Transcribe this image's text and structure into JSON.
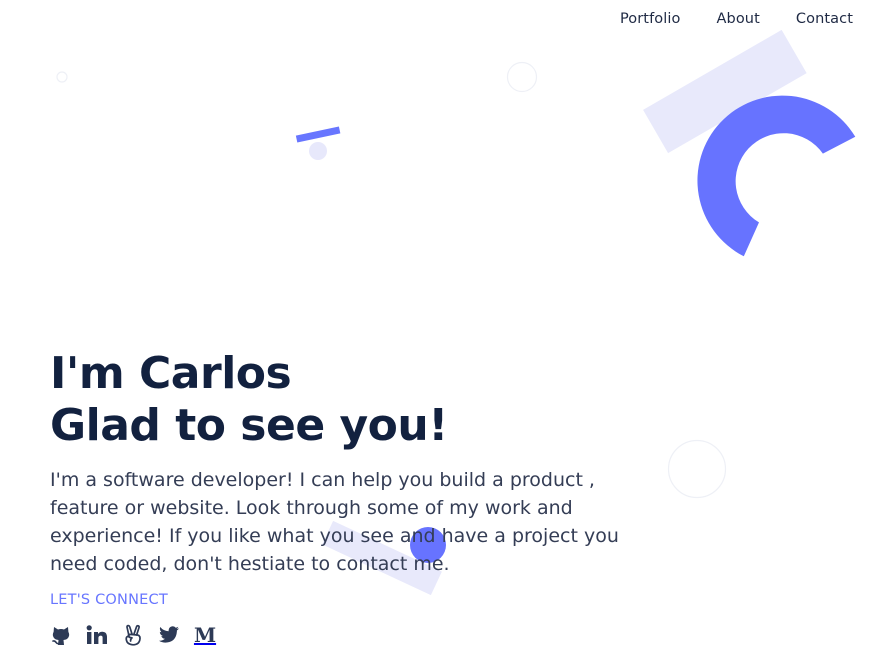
{
  "nav": {
    "items": [
      {
        "label": "Portfolio"
      },
      {
        "label": "About"
      },
      {
        "label": "Contact"
      }
    ]
  },
  "hero": {
    "title_line1": "I'm Carlos",
    "title_line2": "Glad to see you!",
    "description": "I'm a software developer! I can help you build a product , feature or website. Look through some of my work and experience! If you like what you see and have a project you need coded, don't hestiate to contact me."
  },
  "connect": {
    "label": "LET'S CONNECT"
  },
  "socials": [
    {
      "icon": "github-icon"
    },
    {
      "icon": "linkedin-icon"
    },
    {
      "icon": "angellist-icon"
    },
    {
      "icon": "twitter-icon"
    },
    {
      "icon": "medium-icon",
      "glyph": "M"
    }
  ],
  "colors": {
    "accent": "#6876ff",
    "accent_light": "#e8e9fb",
    "heading": "#12213f",
    "body_text": "#343d55",
    "icon": "#2d3a56"
  }
}
